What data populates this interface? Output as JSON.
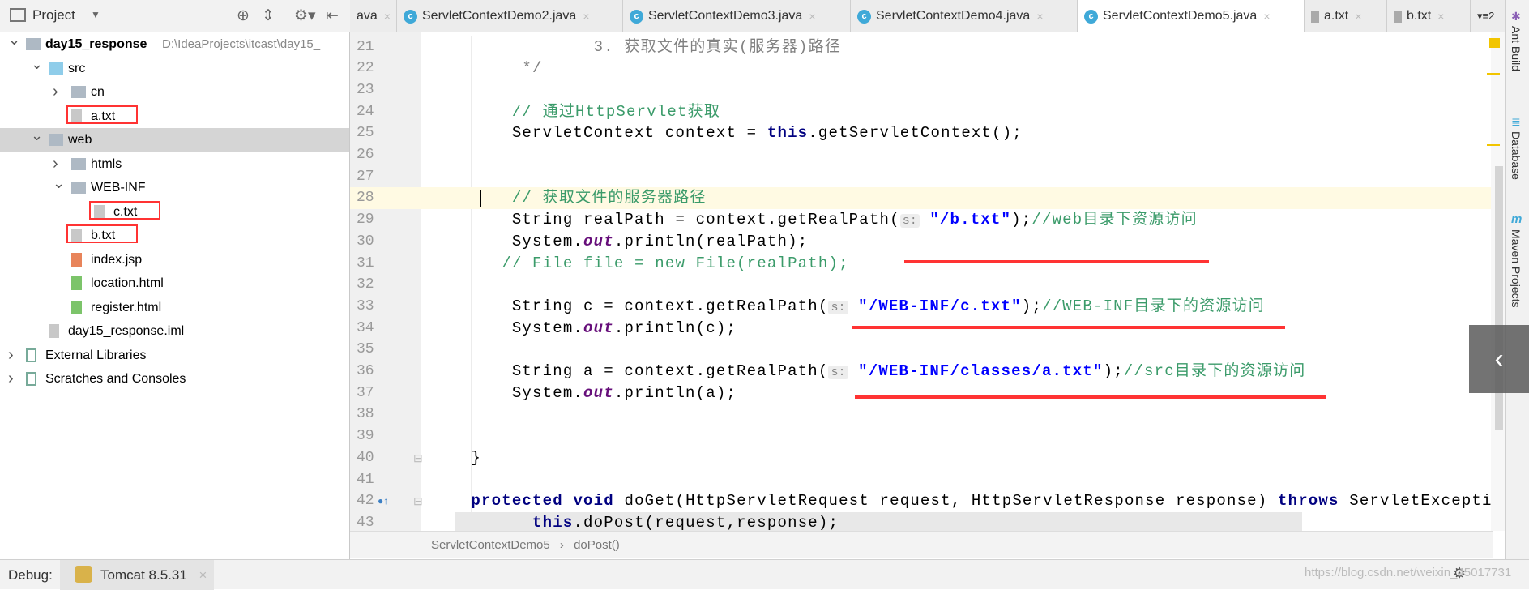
{
  "project_panel": {
    "title": "Project",
    "tree": [
      {
        "label": "day15_response",
        "path": "D:\\IdeaProjects\\itcast\\day15_",
        "level": 0,
        "arrow": "open",
        "icon": "module-folder-icon",
        "bold": true
      },
      {
        "label": "src",
        "level": 1,
        "arrow": "open",
        "icon": "source-folder-icon"
      },
      {
        "label": "cn",
        "level": 2,
        "arrow": "closed",
        "icon": "package-folder-icon"
      },
      {
        "label": "a.txt",
        "level": 2,
        "icon": "text-file-icon",
        "highlighted": true
      },
      {
        "label": "web",
        "level": 1,
        "arrow": "open",
        "icon": "web-folder-icon",
        "selected": true
      },
      {
        "label": "htmls",
        "level": 2,
        "arrow": "closed",
        "icon": "folder-icon"
      },
      {
        "label": "WEB-INF",
        "level": 2,
        "arrow": "open",
        "icon": "folder-icon"
      },
      {
        "label": "c.txt",
        "level": 3,
        "icon": "text-file-icon",
        "highlighted": true
      },
      {
        "label": "b.txt",
        "level": 2,
        "icon": "text-file-icon",
        "highlighted": true
      },
      {
        "label": "index.jsp",
        "level": 2,
        "icon": "jsp-file-icon"
      },
      {
        "label": "location.html",
        "level": 2,
        "icon": "html-file-icon"
      },
      {
        "label": "register.html",
        "level": 2,
        "icon": "html-file-icon"
      },
      {
        "label": "day15_response.iml",
        "level": 1,
        "icon": "iml-file-icon"
      },
      {
        "label": "External Libraries",
        "level": 0,
        "arrow": "closed",
        "icon": "libraries-icon"
      },
      {
        "label": "Scratches and Consoles",
        "level": 0,
        "arrow": "closed",
        "icon": "scratches-icon"
      }
    ]
  },
  "tabs": [
    {
      "label": "ava",
      "icon": "none"
    },
    {
      "label": "ServletContextDemo2.java",
      "icon": "class-icon"
    },
    {
      "label": "ServletContextDemo3.java",
      "icon": "class-icon"
    },
    {
      "label": "ServletContextDemo4.java",
      "icon": "class-icon"
    },
    {
      "label": "ServletContextDemo5.java",
      "icon": "class-icon",
      "active": true
    },
    {
      "label": "a.txt",
      "icon": "text-file-icon"
    },
    {
      "label": "b.txt",
      "icon": "text-file-icon"
    }
  ],
  "tabs_overflow": "▾≡2",
  "editor": {
    "current_line": 28,
    "lines": [
      {
        "n": 21,
        "tokens": [
          [
            "                3. 获取文件的真实(服务器)路径",
            "doc"
          ]
        ]
      },
      {
        "n": 22,
        "tokens": [
          [
            "         */",
            "doc"
          ]
        ]
      },
      {
        "n": 23,
        "tokens": []
      },
      {
        "n": 24,
        "tokens": [
          [
            "        // 通过HttpServlet获取",
            "cm"
          ]
        ]
      },
      {
        "n": 25,
        "tokens": [
          [
            "        ServletContext context = ",
            ""
          ],
          [
            "this",
            "kw"
          ],
          [
            ".getServletContext();",
            ""
          ]
        ]
      },
      {
        "n": 26,
        "tokens": []
      },
      {
        "n": 27,
        "tokens": []
      },
      {
        "n": 28,
        "tokens": [
          [
            "        // 获取文件的服务器路径",
            "cm"
          ]
        ]
      },
      {
        "n": 29,
        "tokens": [
          [
            "        String realPath = context.getRealPath(",
            ""
          ],
          [
            "s:",
            "hint"
          ],
          [
            " ",
            ""
          ],
          [
            "\"/b.txt\"",
            "str"
          ],
          [
            ");",
            ""
          ],
          [
            "//web目录下资源访问",
            "cm"
          ]
        ]
      },
      {
        "n": 30,
        "tokens": [
          [
            "        System.",
            ""
          ],
          [
            "out",
            "fld"
          ],
          [
            ".println(realPath);",
            ""
          ]
        ]
      },
      {
        "n": 31,
        "tokens": [
          [
            "       // File file = new File(realPath);",
            "cm"
          ]
        ]
      },
      {
        "n": 32,
        "tokens": []
      },
      {
        "n": 33,
        "tokens": [
          [
            "        String c = context.getRealPath(",
            ""
          ],
          [
            "s:",
            "hint"
          ],
          [
            " ",
            ""
          ],
          [
            "\"/WEB-INF/c.txt\"",
            "str"
          ],
          [
            ");",
            ""
          ],
          [
            "//WEB-INF目录下的资源访问",
            "cm"
          ]
        ]
      },
      {
        "n": 34,
        "tokens": [
          [
            "        System.",
            ""
          ],
          [
            "out",
            "fld"
          ],
          [
            ".println(c);",
            ""
          ]
        ]
      },
      {
        "n": 35,
        "tokens": []
      },
      {
        "n": 36,
        "tokens": [
          [
            "        String a = context.getRealPath(",
            ""
          ],
          [
            "s:",
            "hint"
          ],
          [
            " ",
            ""
          ],
          [
            "\"/WEB-INF/classes/a.txt\"",
            "str"
          ],
          [
            ");",
            ""
          ],
          [
            "//src目录下的资源访问",
            "cm"
          ]
        ]
      },
      {
        "n": 37,
        "tokens": [
          [
            "        System.",
            ""
          ],
          [
            "out",
            "fld"
          ],
          [
            ".println(a);",
            ""
          ]
        ]
      },
      {
        "n": 38,
        "tokens": []
      },
      {
        "n": 39,
        "tokens": []
      },
      {
        "n": 40,
        "tokens": [
          [
            "    }",
            ""
          ]
        ]
      },
      {
        "n": 41,
        "tokens": []
      },
      {
        "n": 42,
        "tokens": [
          [
            "    ",
            ""
          ],
          [
            "protected void",
            "kw"
          ],
          [
            " doGet(HttpServletRequest request, HttpServletResponse response) ",
            ""
          ],
          [
            "throws",
            "kw"
          ],
          [
            " ServletExceptio",
            ""
          ]
        ]
      },
      {
        "n": 43,
        "tokens": [
          [
            "          ",
            ""
          ],
          [
            "this",
            "kw"
          ],
          [
            ".doPost(request,response);",
            ""
          ]
        ]
      }
    ]
  },
  "breadcrumb": [
    "ServletContextDemo5",
    "doPost()"
  ],
  "breadcrumb_sep": "›",
  "right_tools": [
    "Ant Build",
    "Database",
    "Maven Projects"
  ],
  "debug": {
    "label": "Debug:",
    "config": "Tomcat 8.5.31",
    "close": "×"
  },
  "watermark": "https://blog.csdn.net/weixin_45017731",
  "colors": {
    "annotation_red": "#ff3333",
    "keyword": "#000080",
    "string": "#0000ff",
    "comment": "#3b9b6a",
    "current_line": "#fffae3"
  }
}
